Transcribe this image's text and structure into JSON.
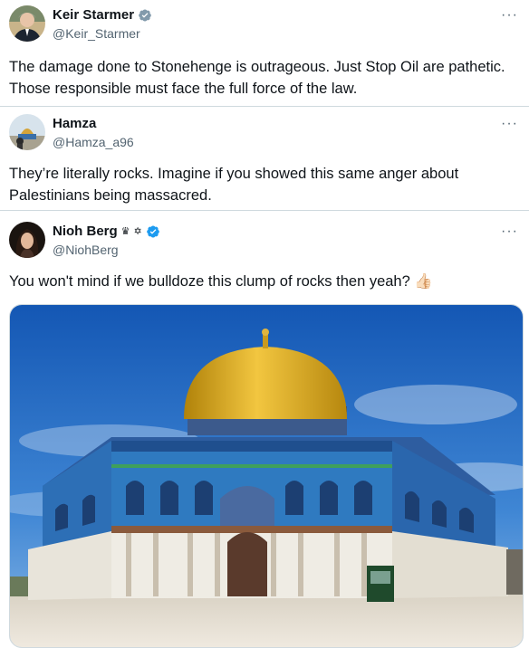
{
  "tweets": [
    {
      "name": "Keir Starmer",
      "handle": "@Keir_Starmer",
      "text": "The damage done to Stonehenge is outrageous. Just Stop Oil are pathetic. Those responsible must face the full force of the law.",
      "verified": "gray-check-badge",
      "more": "···"
    },
    {
      "name": "Hamza",
      "handle": "@Hamza_a96",
      "text": "They’re literally rocks. Imagine if you showed this same anger about Palestinians being massacred.",
      "more": "···"
    },
    {
      "name": "Nioh Berg",
      "handle": "@NiohBerg",
      "text": "You won't mind if we bulldoze this clump of rocks then yeah? 👍🏻",
      "name_emoji_1": "♛",
      "name_emoji_2": "✡",
      "verified": "blue-check-badge",
      "more": "···",
      "media": "dome-of-the-rock-photo"
    }
  ],
  "colors": {
    "text": "#0f1419",
    "secondary": "#536471",
    "verified_blue": "#1d9bf0",
    "verified_gray": "#829aab",
    "border": "#cfd9de"
  }
}
